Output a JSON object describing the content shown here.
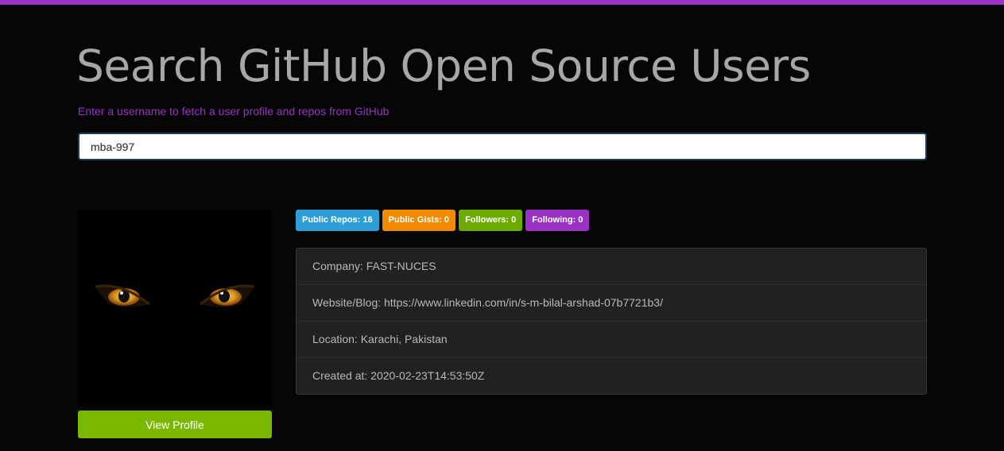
{
  "header": {
    "title": "Search GitHub Open Source Users",
    "subtitle": "Enter a username to fetch a user profile and repos from GitHub"
  },
  "search": {
    "value": "mba-997",
    "placeholder": ""
  },
  "profile": {
    "view_profile_label": "View Profile",
    "avatar_icon": "cat-eyes-avatar"
  },
  "badges": [
    {
      "label": "Public Repos: 16",
      "color": "#2d9fd6"
    },
    {
      "label": "Public Gists: 0",
      "color": "#f08a00"
    },
    {
      "label": "Followers: 0",
      "color": "#6cac00"
    },
    {
      "label": "Following: 0",
      "color": "#9b32c4"
    }
  ],
  "info": {
    "company": "Company: FAST-NUCES",
    "website": "Website/Blog: https://www.linkedin.com/in/s-m-bilal-arshad-07b7721b3/",
    "location": "Location: Karachi, Pakistan",
    "created": "Created at: 2020-02-23T14:53:50Z"
  },
  "colors": {
    "accent": "#9b32c4",
    "background": "#060606",
    "button": "#7ab800"
  }
}
